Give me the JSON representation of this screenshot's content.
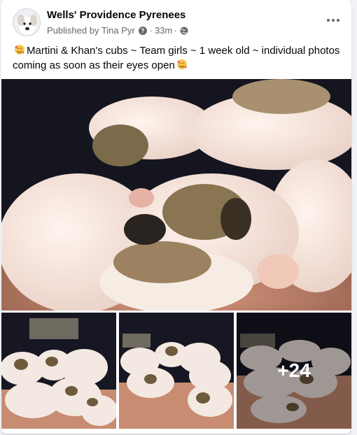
{
  "post": {
    "page_name": "Wells' Providence Pyrenees",
    "published_by": "Published by Tina Pyr",
    "time": "33m",
    "separator": "·",
    "text": "Martini & Khan's cubs ~ Team girls ~ 1 week old ~ individual photos coming as soon as their eyes open"
  },
  "photos": {
    "more_count": "+24"
  },
  "icons": {
    "more": "more-options-icon",
    "info": "question-icon",
    "privacy": "globe-icon",
    "emoji": "smiling-face-with-hearts-icon"
  },
  "colors": {
    "page_bg": "#f0f2f5",
    "card_bg": "#ffffff",
    "name": "#050505",
    "meta": "#65676b"
  }
}
